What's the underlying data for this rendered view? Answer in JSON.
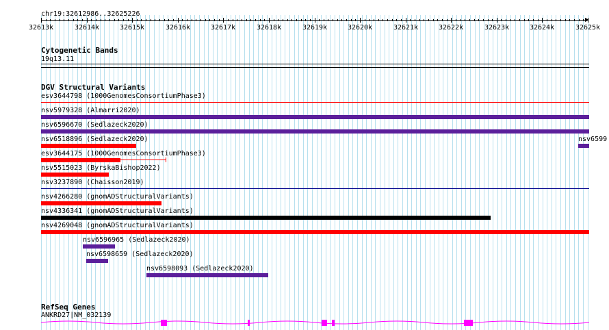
{
  "ruler": {
    "range_label": "chr19:32612986..32625226",
    "ticks": [
      "32613k",
      "32614k",
      "32615k",
      "32616k",
      "32617k",
      "32618k",
      "32619k",
      "32620k",
      "32621k",
      "32622k",
      "32623k",
      "32624k",
      "32625k"
    ]
  },
  "tracks": {
    "cytoband": {
      "title": "Cytogenetic Bands",
      "band_label": "19q13.11"
    },
    "dgv": {
      "title": "DGV Structural Variants",
      "features": [
        {
          "label": "esv3644798 (1000GenomesConsortiumPhase3)",
          "color": "#ff0000",
          "style": "thin"
        },
        {
          "label": "nsv5979328 (Almarri2020)",
          "color": "#5b1f9b",
          "style": "bar"
        },
        {
          "label": "nsv6596670 (Sedlazeck2020)",
          "color": "#5b1f9b",
          "style": "bar"
        },
        {
          "label": "nsv6518896 (Sedlazeck2020)",
          "color": "#ff0000",
          "style": "bar"
        },
        {
          "label": "nsv6599",
          "color": "#5b1f9b",
          "style": "bar"
        },
        {
          "label": "esv3644175 (1000GenomesConsortiumPhase3)",
          "color": "#ff0000",
          "style": "bar+whisker"
        },
        {
          "label": "nsv5515023 (ByrskaBishop2022)",
          "color": "#ff0000",
          "style": "bar"
        },
        {
          "label": "nsv3237890 (Chaisson2019)",
          "color": "#00008b",
          "style": "thin"
        },
        {
          "label": "nsv4266280 (gnomADStructuralVariants)",
          "color": "#ff0000",
          "style": "bar"
        },
        {
          "label": "nsv4336341 (gnomADStructuralVariants)",
          "color": "#000000",
          "style": "bar"
        },
        {
          "label": "nsv4269048 (gnomADStructuralVariants)",
          "color": "#ff0000",
          "style": "bar"
        },
        {
          "label": "nsv6596965 (Sedlazeck2020)",
          "color": "#5b1f9b",
          "style": "bar"
        },
        {
          "label": "nsv6598659 (Sedlazeck2020)",
          "color": "#5b1f9b",
          "style": "bar"
        },
        {
          "label": "nsv6598093 (Sedlazeck2020)",
          "color": "#5b1f9b",
          "style": "bar"
        }
      ]
    },
    "refseq": {
      "title": "RefSeq Genes",
      "gene_label": "ANKRD27|NM_032139",
      "color": "#ff00ff"
    }
  },
  "colors": {
    "grid": "#b7e0ee",
    "gene": "#ff00ff",
    "variant_red": "#ff0000",
    "variant_purple": "#5b1f9b",
    "variant_black": "#000000"
  }
}
